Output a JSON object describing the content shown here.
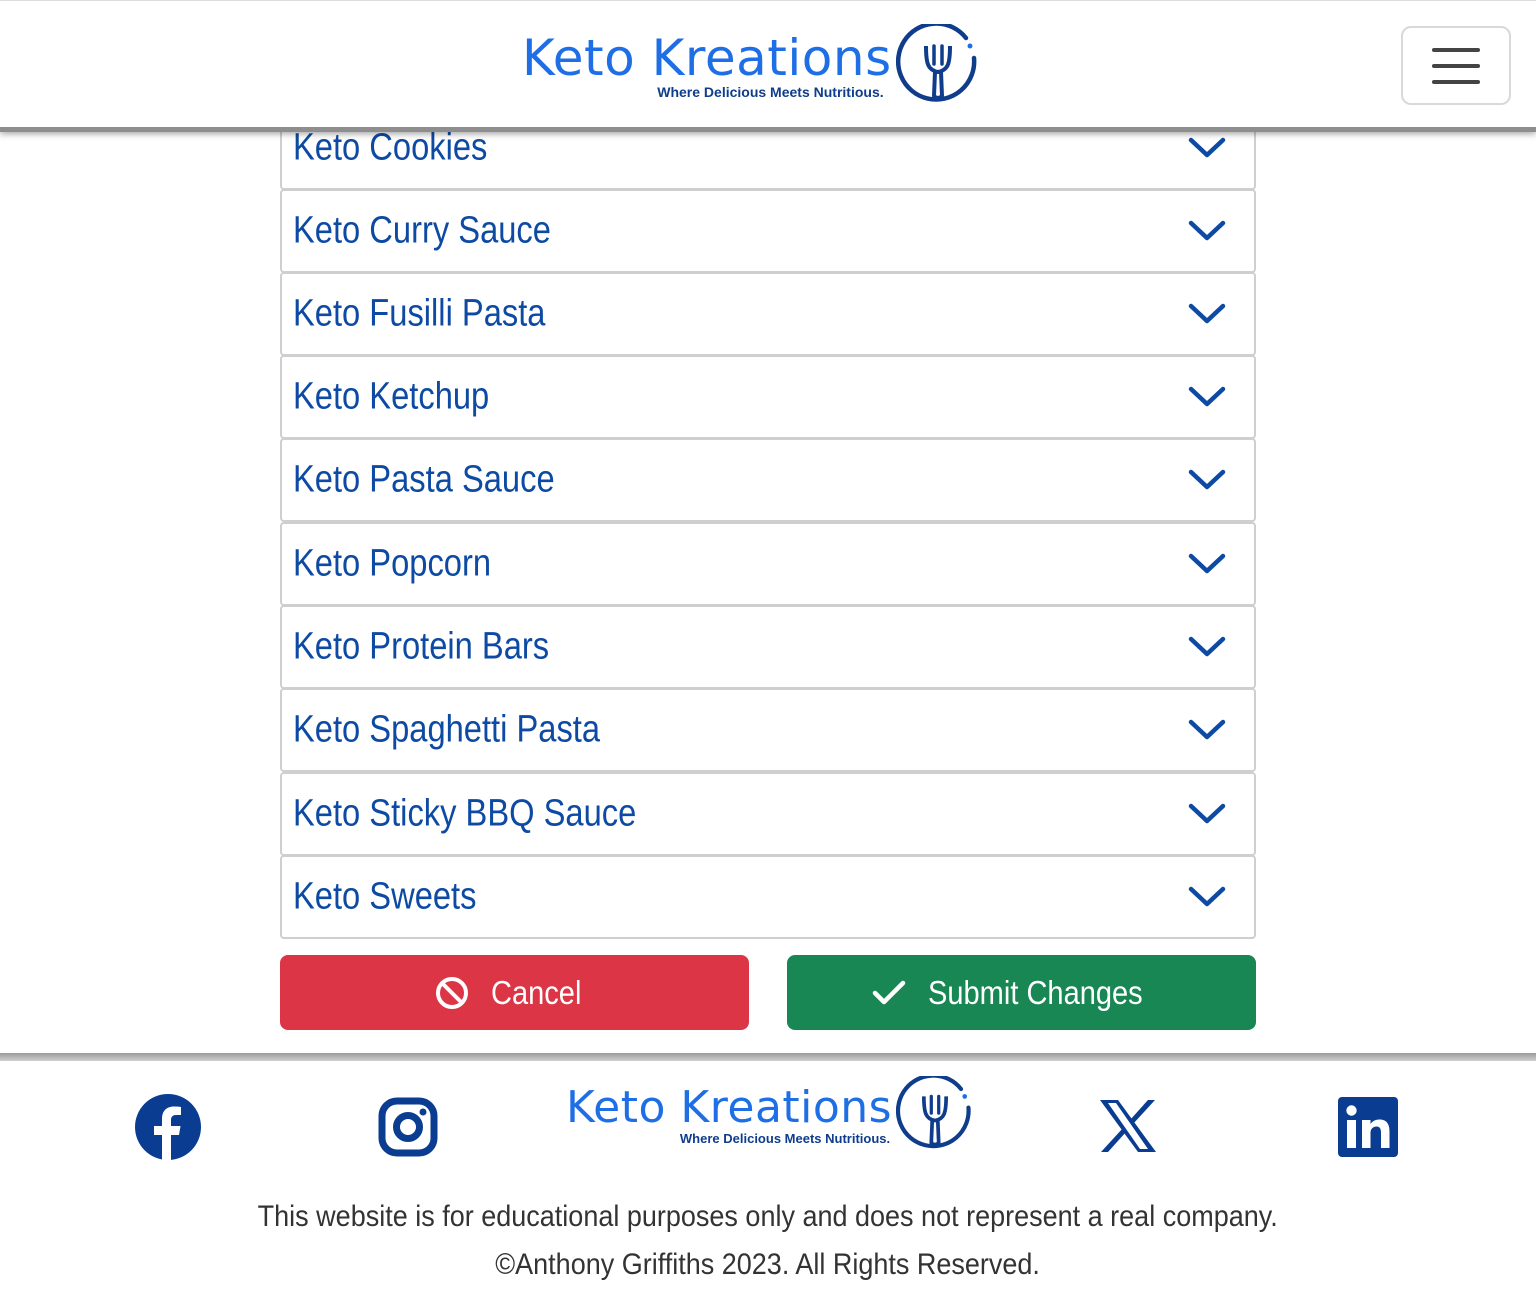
{
  "header": {
    "brand_name": "Keto Kreations",
    "brand_tagline": "Where Delicious Meets Nutritious.",
    "menu_icon": "hamburger-menu-icon"
  },
  "recipes": [
    {
      "label": "Keto Cookies"
    },
    {
      "label": "Keto Curry Sauce"
    },
    {
      "label": "Keto Fusilli Pasta"
    },
    {
      "label": "Keto Ketchup"
    },
    {
      "label": "Keto Pasta Sauce"
    },
    {
      "label": "Keto Popcorn"
    },
    {
      "label": "Keto Protein Bars"
    },
    {
      "label": "Keto Spaghetti Pasta"
    },
    {
      "label": "Keto Sticky BBQ Sauce"
    },
    {
      "label": "Keto Sweets"
    }
  ],
  "actions": {
    "cancel_label": "Cancel",
    "submit_label": "Submit Changes"
  },
  "footer": {
    "brand_name": "Keto Kreations",
    "brand_tagline": "Where Delicious Meets Nutritious.",
    "disclaimer": "This website is for educational purposes only and does not represent a real company.",
    "copyright": "©Anthony Griffiths 2023. All Rights Reserved.",
    "social": [
      "facebook-icon",
      "instagram-icon",
      "x-icon",
      "linkedin-icon"
    ]
  },
  "colors": {
    "brand_blue": "#1e6fe6",
    "brand_navy": "#0f3d8c",
    "item_text": "#0d4aa3",
    "cancel": "#dc3545",
    "submit": "#198754",
    "social": "#0a3d91"
  }
}
